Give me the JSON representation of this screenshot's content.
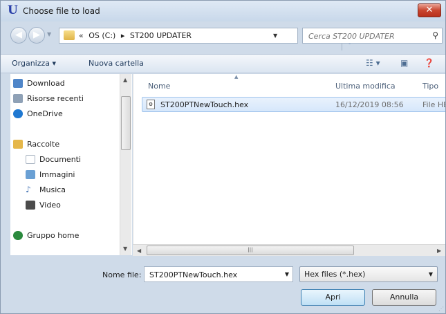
{
  "window": {
    "title": "Choose file to load",
    "app_icon_glyph": "U",
    "close_glyph": "✕"
  },
  "address_bar": {
    "breadcrumbs": [
      "«",
      "OS (C:)",
      "▸",
      "ST200 UPDATER"
    ],
    "search_placeholder": "Cerca ST200 UPDATER"
  },
  "toolbar": {
    "organize_label": "Organizza ▾",
    "new_folder_label": "Nuova cartella"
  },
  "nav_pane": {
    "items": [
      {
        "label": "Download",
        "icon": "download-folder-icon",
        "color": "#4f86c9"
      },
      {
        "label": "Risorse recenti",
        "icon": "recent-places-icon",
        "color": "#8fa1b6"
      },
      {
        "label": "OneDrive",
        "icon": "cloud-icon",
        "color": "#1f78d1"
      },
      {
        "label": "Raccolte",
        "icon": "libraries-icon",
        "color": "#e5b74a"
      },
      {
        "label": "Documenti",
        "icon": "documents-icon",
        "color": "#a9b4c2"
      },
      {
        "label": "Immagini",
        "icon": "pictures-icon",
        "color": "#6aa0d4"
      },
      {
        "label": "Musica",
        "icon": "music-icon",
        "color": "#3f6fb1"
      },
      {
        "label": "Video",
        "icon": "video-icon",
        "color": "#4b4b4b"
      },
      {
        "label": "Gruppo home",
        "icon": "homegroup-icon",
        "color": "#2b8a3e"
      }
    ]
  },
  "file_list": {
    "columns": [
      "Nome",
      "Ultima modifica",
      "Tipo"
    ],
    "rows": [
      {
        "name": "ST200PTNewTouch.hex",
        "modified": "16/12/2019 08:56",
        "type": "File HE"
      }
    ]
  },
  "footer": {
    "filename_label": "Nome file:",
    "filename_value": "ST200PTNewTouch.hex",
    "filter_value": "Hex files (*.hex)",
    "open_label": "Apri",
    "cancel_label": "Annulla"
  }
}
